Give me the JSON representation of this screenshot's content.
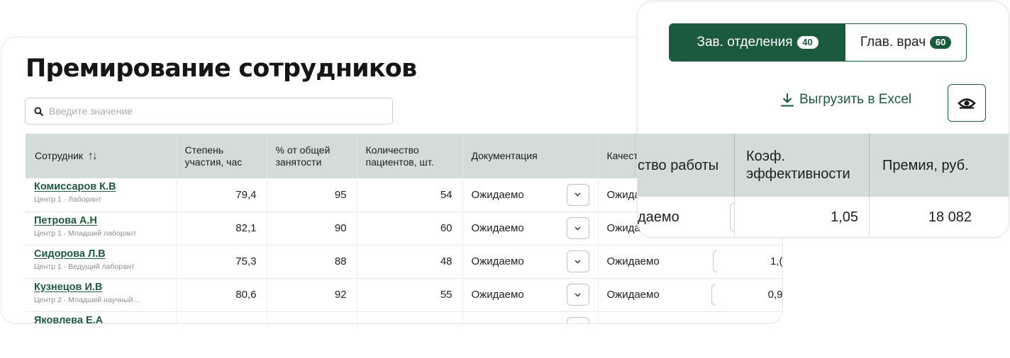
{
  "page": {
    "title": "Премирование сотрудников",
    "search_placeholder": "Введите значение"
  },
  "table": {
    "columns": {
      "employee": "Сотрудник",
      "participation": "Степень участия, час",
      "employment": "% от общей занятости",
      "patients": "Количество пациентов, шт.",
      "documentation": "Документация",
      "quality": "Качество работы"
    },
    "rows": [
      {
        "name": "Комиссаров К.В",
        "role": "Центр 1 · Лаборант",
        "participation": "79,4",
        "employment": "95",
        "patients": "54",
        "documentation": "Ожидаемо",
        "quality": "Ожидаемо",
        "coef": ""
      },
      {
        "name": "Петрова А.Н",
        "role": "Центр 1 · Младший лаборант",
        "participation": "82,1",
        "employment": "90",
        "patients": "60",
        "documentation": "Ожидаемо",
        "quality": "Ожидаемо",
        "coef": ""
      },
      {
        "name": "Сидорова Л.В",
        "role": "Центр 1 · Ведущий лаборант",
        "participation": "75,3",
        "employment": "88",
        "patients": "48",
        "documentation": "Ожидаемо",
        "quality": "Ожидаемо",
        "coef": "1,("
      },
      {
        "name": "Кузнецов И.В",
        "role": "Центр 2 · Младший научный...",
        "participation": "80,6",
        "employment": "92",
        "patients": "55",
        "documentation": "Ожидаемо",
        "quality": "Ожидаемо",
        "coef": "0,9"
      },
      {
        "name": "Яковлева Е.А",
        "role": "",
        "participation": "",
        "employment": "",
        "patients": "",
        "documentation": "",
        "quality": "",
        "coef": ""
      }
    ]
  },
  "panel": {
    "tabs": [
      {
        "label": "Зав. отделения",
        "count": "40",
        "active": true
      },
      {
        "label": "Глав. врач",
        "count": "60",
        "active": false
      }
    ],
    "export_label": "Выгрузить в Excel",
    "view_icon": "eye-icon",
    "columns": {
      "quality_partial": "ство работы",
      "coef": "Коэф. эффективности",
      "bonus": "Премия, руб."
    },
    "row": {
      "quality_partial": "даемо",
      "coef": "1,05",
      "bonus": "18 082"
    }
  },
  "colors": {
    "accent": "#1b5a3c",
    "header_bg": "#d2ddd8",
    "link": "#1f5a3e"
  }
}
